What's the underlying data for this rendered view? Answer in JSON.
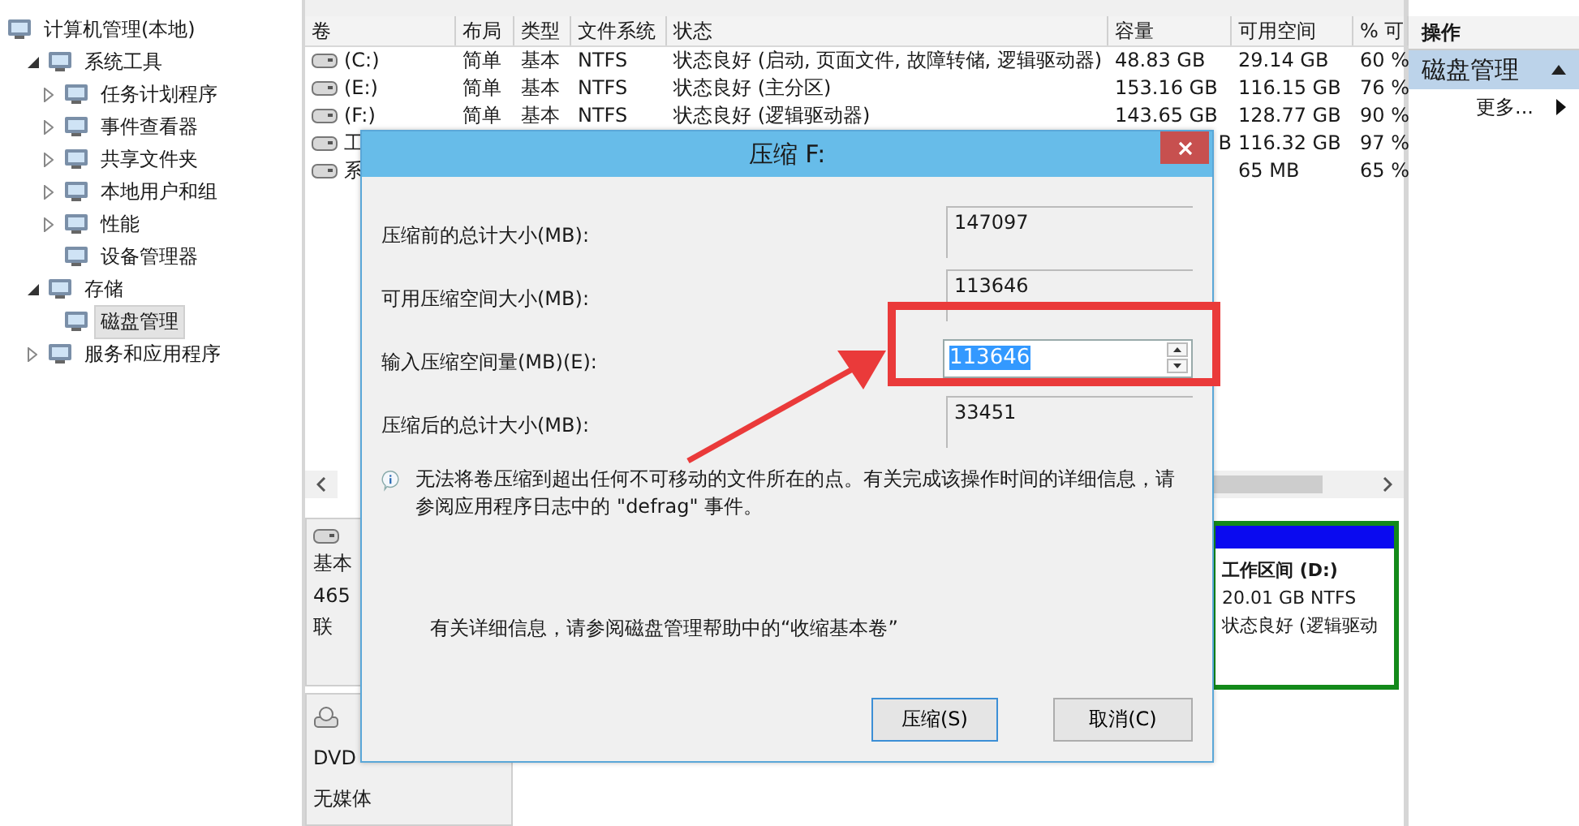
{
  "tree": [
    {
      "label": "计算机管理(本地)",
      "selected": false,
      "children": [
        {
          "label": "系统工具",
          "expanded": true,
          "selected": false,
          "children": [
            {
              "label": "任务计划程序",
              "expanded": false,
              "selected": false
            },
            {
              "label": "事件查看器",
              "expanded": false,
              "selected": false
            },
            {
              "label": "共享文件夹",
              "expanded": false,
              "selected": false
            },
            {
              "label": "本地用户和组",
              "expanded": false,
              "selected": false
            },
            {
              "label": "性能",
              "expanded": false,
              "selected": false
            },
            {
              "label": "设备管理器",
              "selected": false
            }
          ]
        },
        {
          "label": "存储",
          "expanded": true,
          "selected": false,
          "children": [
            {
              "label": "磁盘管理",
              "selected": true
            }
          ]
        },
        {
          "label": "服务和应用程序",
          "expanded": false,
          "selected": false
        }
      ]
    }
  ],
  "volume_table": {
    "columns": [
      "卷",
      "布局",
      "类型",
      "文件系统",
      "状态",
      "容量",
      "可用空间",
      "% 可"
    ],
    "rows": [
      {
        "cells": [
          "(C:)",
          "简单",
          "基本",
          "NTFS",
          "状态良好 (启动, 页面文件, 故障转储, 逻辑驱动器)",
          "48.83 GB",
          "29.14 GB",
          "60 %"
        ]
      },
      {
        "cells": [
          "(E:)",
          "简单",
          "基本",
          "NTFS",
          "状态良好 (主分区)",
          "153.16 GB",
          "116.15 GB",
          "76 %"
        ]
      },
      {
        "cells": [
          "(F:)",
          "简单",
          "基本",
          "NTFS",
          "状态良好 (逻辑驱动器)",
          "143.65 GB",
          "128.77 GB",
          "90 %"
        ]
      },
      {
        "cells": [
          "工",
          null,
          null,
          null,
          null,
          "B",
          "116.32 GB",
          "97 %"
        ]
      },
      {
        "cells": [
          "系",
          null,
          null,
          null,
          null,
          null,
          "65 MB",
          "65 %"
        ]
      }
    ]
  },
  "disk_panel": {
    "disks": [
      {
        "kind": "hdd",
        "lines": [
          "基本",
          "465",
          "联"
        ]
      },
      {
        "kind": "dvd",
        "lines": [
          "DVD",
          "无媒体"
        ]
      }
    ],
    "partition": {
      "title": "工作区间 (D:)",
      "size": "20.01 GB NTFS",
      "status": "状态良好 (逻辑驱动"
    }
  },
  "actions": {
    "title": "操作",
    "section": {
      "label": "磁盘管理",
      "expanded": true
    },
    "items": [
      {
        "label": "更多..."
      }
    ]
  },
  "dialog": {
    "title": "压缩 F:",
    "fields": [
      {
        "kind": "readonly",
        "label": "压缩前的总计大小(MB):",
        "value": "147097"
      },
      {
        "kind": "readonly",
        "label": "可用压缩空间大小(MB):",
        "value": "113646"
      },
      {
        "kind": "spinner",
        "label": "输入压缩空间量(MB)(E):",
        "value": "113646"
      },
      {
        "kind": "readonly",
        "label": "压缩后的总计大小(MB):",
        "value": "33451"
      }
    ],
    "note": "无法将卷压缩到超出任何不可移动的文件所在的点。有关完成该操作时间的详细信息，请参阅应用程序日志中的 \"defrag\" 事件。",
    "help": "有关详细信息，请参阅磁盘管理帮助中的“收缩基本卷”",
    "buttons": [
      {
        "label": "压缩(S)",
        "default": true
      },
      {
        "label": "取消(C)",
        "default": false
      }
    ]
  }
}
